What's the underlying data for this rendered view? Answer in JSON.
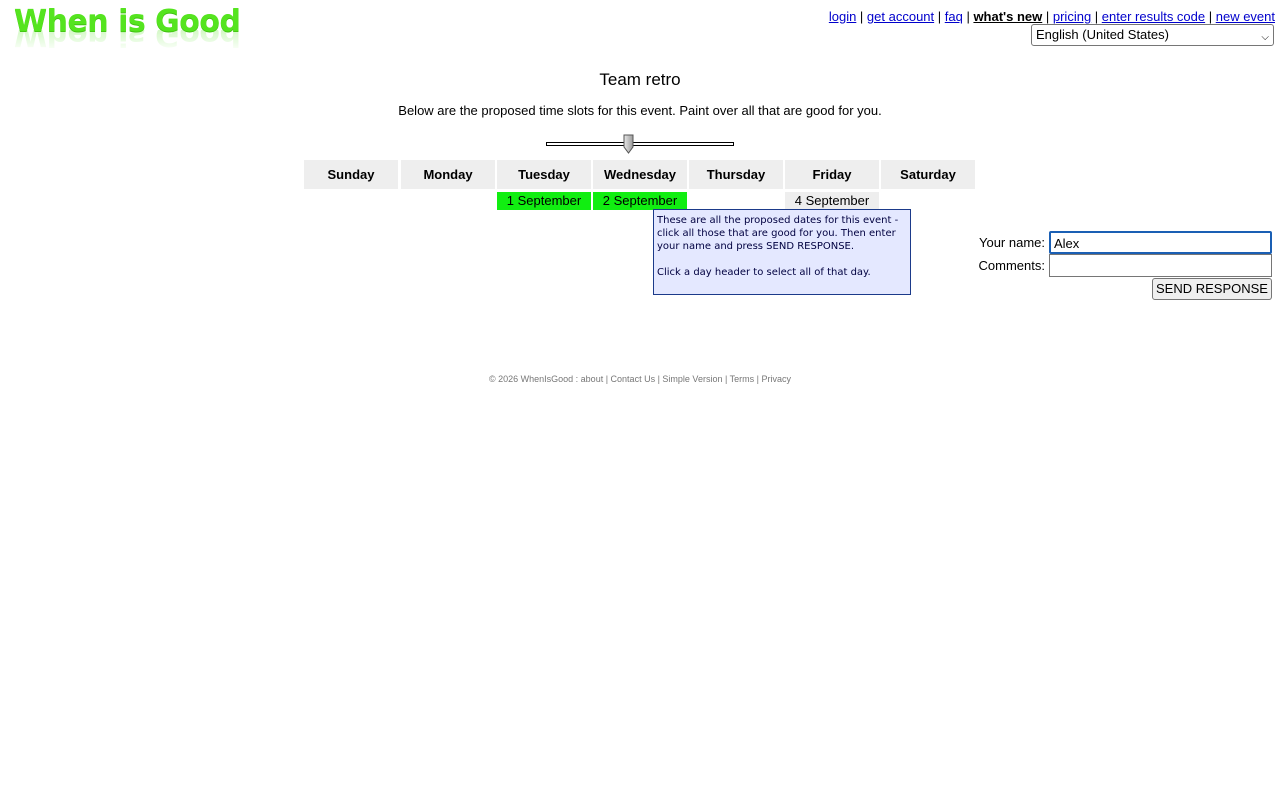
{
  "brand": {
    "logo_text": "When is Good",
    "logo_color": "#55e41f"
  },
  "nav": {
    "login": "login",
    "get_account": "get account",
    "faq": "faq",
    "whats_new": "what's new",
    "pricing": "pricing",
    "enter_results_code": "enter results code",
    "new_event": "new event",
    "separator": " | "
  },
  "language_select": {
    "selected": "English (United States)"
  },
  "event": {
    "title": "Team retro",
    "instructions": "Below are the proposed time slots for this event. Paint over all that are good for you."
  },
  "calendar": {
    "days": [
      "Sunday",
      "Monday",
      "Tuesday",
      "Wednesday",
      "Thursday",
      "Friday",
      "Saturday"
    ],
    "slots": {
      "tuesday": "1 September",
      "wednesday": "2 September",
      "friday": "4 September"
    },
    "good_color": "#11ee11",
    "neutral_color": "#eeeeee"
  },
  "tooltip": {
    "line1": "These are all the proposed dates for this event - click all those that are good for you. Then enter your name and press SEND RESPONSE.",
    "line2": "Click a day header to select all of that day."
  },
  "form": {
    "name_label": "Your name:",
    "name_value": "Alex",
    "comments_label": "Comments:",
    "comments_value": "",
    "send_label": "SEND RESPONSE"
  },
  "footer": {
    "copyright": "© 2026 WhenIsGood : ",
    "about": "about",
    "contact": "Contact Us",
    "simple": "Simple Version",
    "terms": "Terms",
    "privacy": "Privacy",
    "separator": " | "
  }
}
